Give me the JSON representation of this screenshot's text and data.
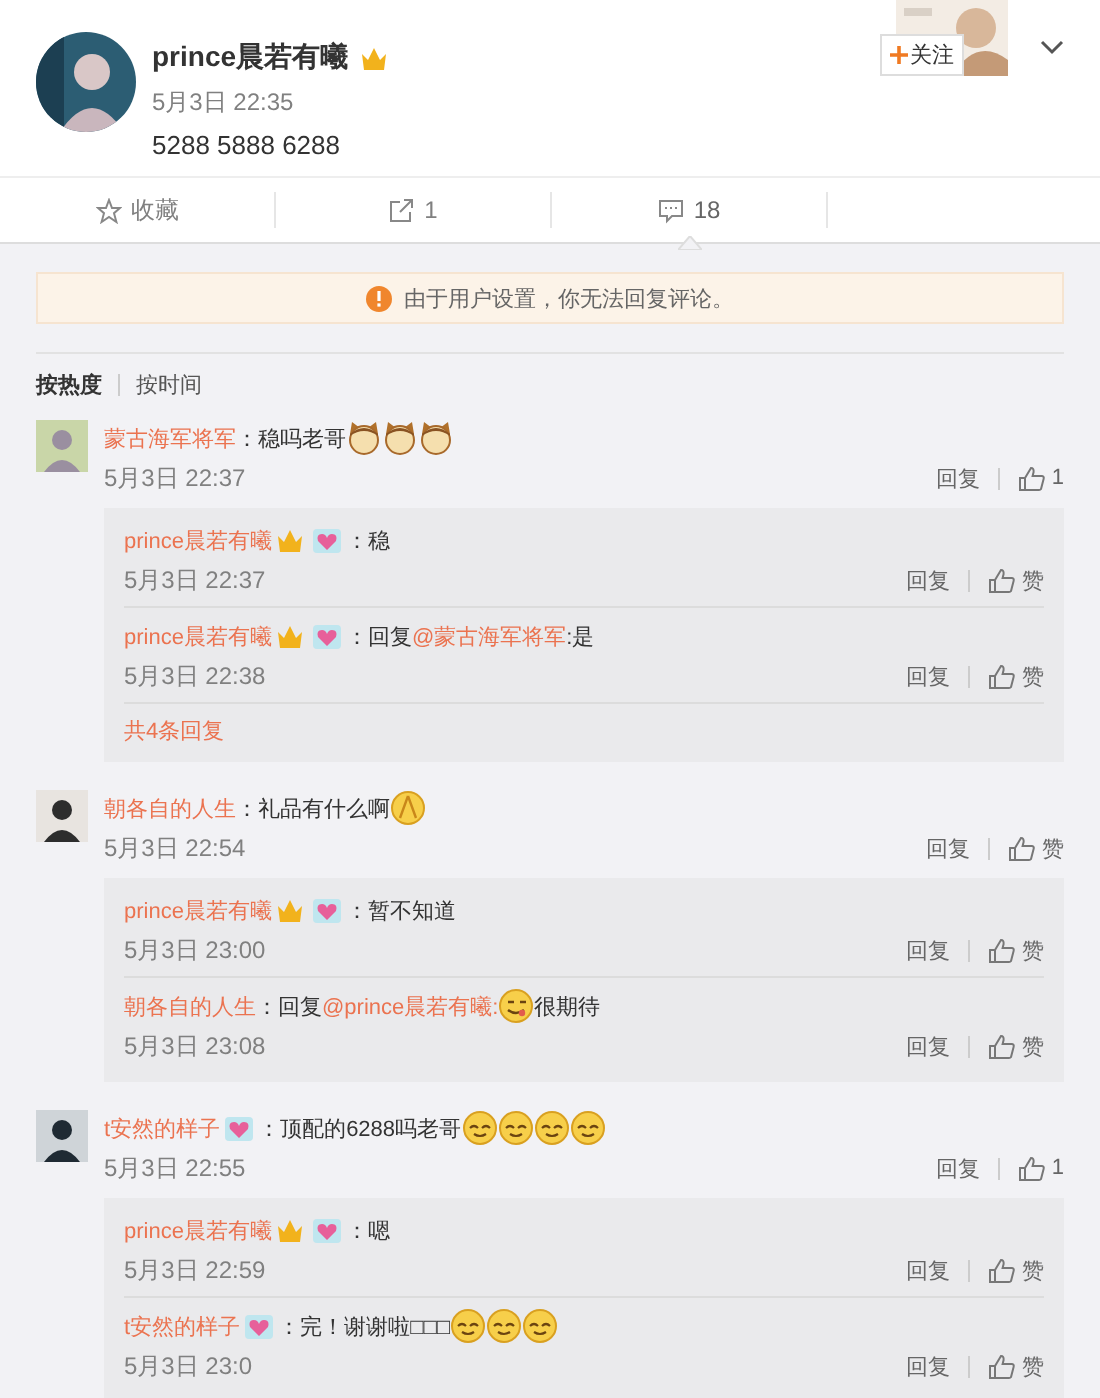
{
  "post": {
    "author": "prince晨若有曦",
    "time": "5月3日 22:35",
    "text": "5288 5888 6288",
    "follow_button": "关注"
  },
  "actions": [
    {
      "kind": "favorite",
      "label": "收藏",
      "selected": false
    },
    {
      "kind": "repost",
      "label": "1",
      "selected": false
    },
    {
      "kind": "comment",
      "label": "18",
      "selected": true
    }
  ],
  "notice": "由于用户设置，你无法回复评论。",
  "sort_tabs": [
    {
      "label": "按热度",
      "selected": true
    },
    {
      "label": "按时间",
      "selected": false
    }
  ],
  "comments": [
    {
      "author": "蒙古海军将军",
      "content": [
        {
          "kind": "plain",
          "text": "：稳吗老哥"
        },
        {
          "kind": "cat"
        },
        {
          "kind": "cat"
        },
        {
          "kind": "cat"
        }
      ],
      "time": "5月3日 22:37",
      "reply_label": "回复",
      "likes": "1",
      "replies": [
        {
          "author": "prince晨若有曦",
          "badges": [
            {
              "kind": "vip"
            },
            {
              "kind": "heart"
            }
          ],
          "content": [
            {
              "kind": "plain",
              "text": "：稳"
            }
          ],
          "time": "5月3日 22:37",
          "reply_label": "回复",
          "likes": "赞"
        },
        {
          "author": "prince晨若有曦",
          "badges": [
            {
              "kind": "vip"
            },
            {
              "kind": "heart"
            }
          ],
          "content": [
            {
              "kind": "plain",
              "text": "：回复"
            },
            {
              "kind": "mention",
              "text": "@蒙古海军将军"
            },
            {
              "kind": "plain",
              "text": ":是"
            }
          ],
          "time": "5月3日 22:38",
          "reply_label": "回复",
          "likes": "赞"
        }
      ],
      "more": "共4条回复"
    },
    {
      "author": "朝各自的人生",
      "content": [
        {
          "kind": "plain",
          "text": "：礼品有什么啊"
        },
        {
          "kind": "pray"
        }
      ],
      "time": "5月3日 22:54",
      "reply_label": "回复",
      "likes": "赞",
      "replies": [
        {
          "author": "prince晨若有曦",
          "badges": [
            {
              "kind": "vip"
            },
            {
              "kind": "heart"
            }
          ],
          "content": [
            {
              "kind": "plain",
              "text": "：暂不知道"
            }
          ],
          "time": "5月3日 23:00",
          "reply_label": "回复",
          "likes": "赞"
        },
        {
          "author": "朝各自的人生",
          "content": [
            {
              "kind": "plain",
              "text": "：回复"
            },
            {
              "kind": "mention",
              "text": "@prince晨若有曦:"
            },
            {
              "kind": "smirk"
            },
            {
              "kind": "plain",
              "text": "很期待"
            }
          ],
          "time": "5月3日 23:08",
          "reply_label": "回复",
          "likes": "赞"
        }
      ]
    },
    {
      "author": "t安然的样子",
      "badges": [
        {
          "kind": "heart"
        }
      ],
      "content": [
        {
          "kind": "plain",
          "text": "：顶配的6288吗老哥"
        },
        {
          "kind": "blush"
        },
        {
          "kind": "blush"
        },
        {
          "kind": "blush"
        },
        {
          "kind": "blush"
        }
      ],
      "time": "5月3日 22:55",
      "reply_label": "回复",
      "likes": "1",
      "replies": [
        {
          "author": "prince晨若有曦",
          "badges": [
            {
              "kind": "vip"
            },
            {
              "kind": "heart"
            }
          ],
          "content": [
            {
              "kind": "plain",
              "text": "：嗯"
            }
          ],
          "time": "5月3日 22:59",
          "reply_label": "回复",
          "likes": "赞"
        },
        {
          "author": "t安然的样子",
          "badges": [
            {
              "kind": "heart"
            }
          ],
          "content": [
            {
              "kind": "plain",
              "text": "：完！谢谢啦□□□"
            },
            {
              "kind": "blush"
            },
            {
              "kind": "blush"
            },
            {
              "kind": "blush"
            }
          ],
          "time": "5月3日 23:0",
          "reply_label": "回复",
          "likes": "赞"
        }
      ]
    }
  ]
}
